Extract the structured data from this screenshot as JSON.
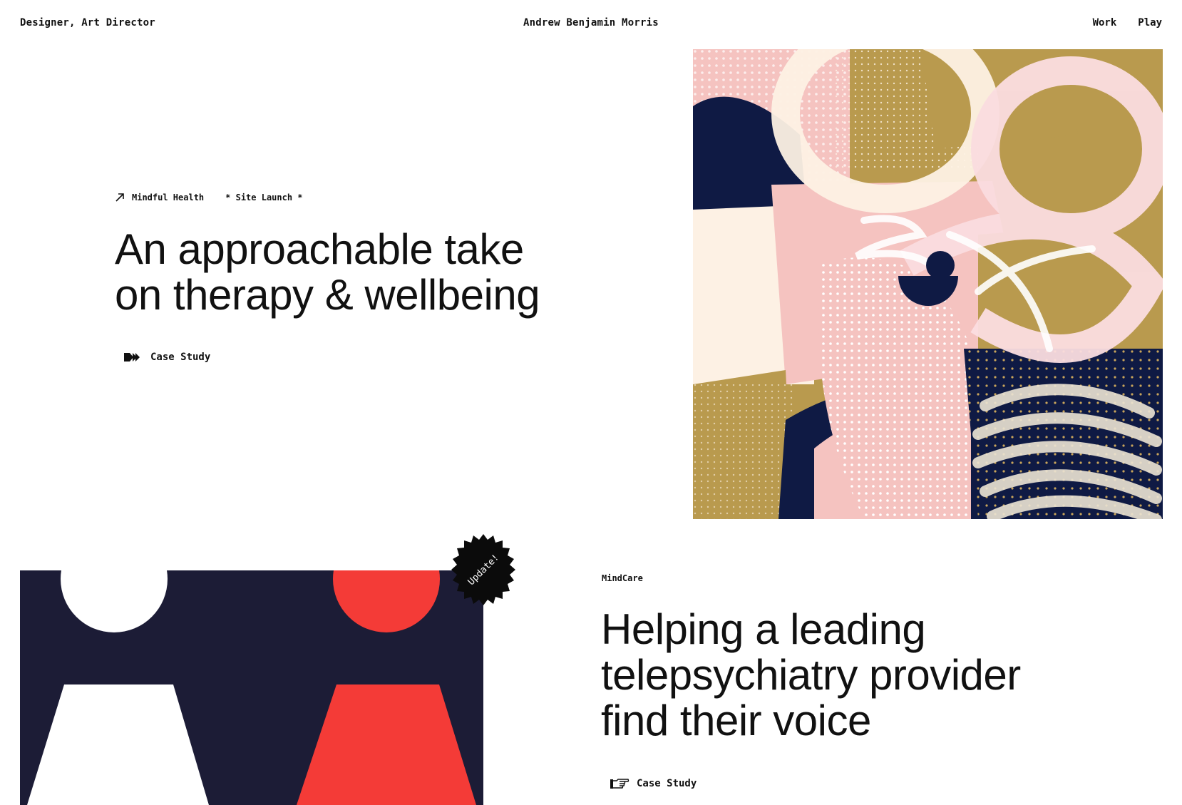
{
  "header": {
    "role": "Designer, Art Director",
    "name": "Andrew Benjamin Morris",
    "nav": [
      {
        "label": "Work"
      },
      {
        "label": "Play"
      }
    ]
  },
  "projects": [
    {
      "client": "Mindful Health",
      "tag": "* Site Launch *",
      "title_lines": [
        "An approachable take",
        "on therapy & wellbeing"
      ],
      "cta": "Case Study"
    },
    {
      "client": "MindCare",
      "badge": "Update!",
      "title_lines": [
        "Helping a leading",
        "telepsychiatry provider",
        "find their voice"
      ],
      "cta": "Case Study"
    }
  ],
  "colors": {
    "navy": "#0f1a44",
    "pink": "#f5c3c0",
    "light_pink": "#fbdde0",
    "mustard": "#b99a4e",
    "cream": "#fdf1e4",
    "dark_navy": "#1c1c36",
    "red": "#f43b37"
  },
  "icons": {
    "p1_meta": "arrow-up-right-icon",
    "p1_cta": "double-arrow-icon",
    "p2_cta": "pointing-hand-icon"
  }
}
